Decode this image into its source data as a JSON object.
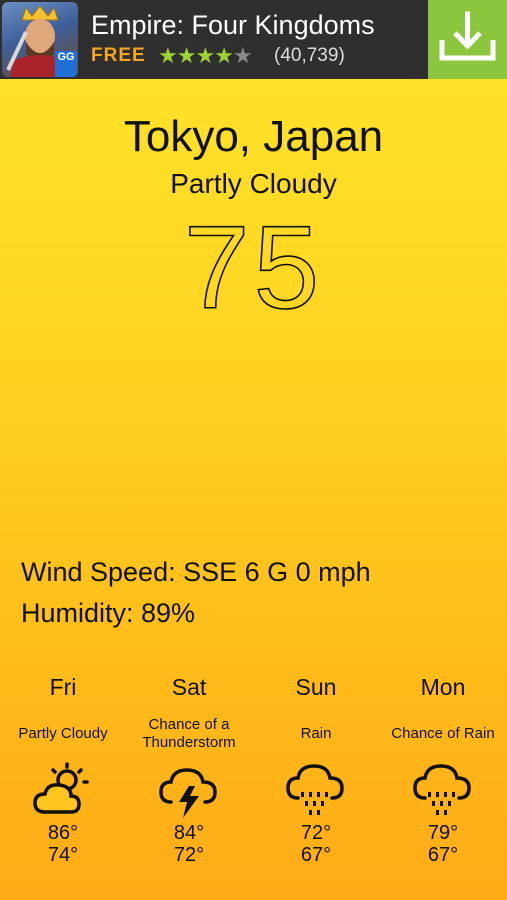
{
  "ad": {
    "title": "Empire: Four Kingdoms",
    "price": "FREE",
    "rating_stars": 4,
    "rating_count": "(40,739)",
    "icon_badge": "GG",
    "download_icon": "download-icon",
    "download_color": "#8cc63f"
  },
  "weather": {
    "city": "Tokyo, Japan",
    "condition": "Partly Cloudy",
    "temperature": "75",
    "wind": "Wind Speed: SSE 6 G 0 mph",
    "humidity": "Humidity: 89%"
  },
  "forecast": [
    {
      "day": "Fri",
      "condition": "Partly Cloudy",
      "icon": "partly-cloudy-icon",
      "high": "86°",
      "low": "74°"
    },
    {
      "day": "Sat",
      "condition": "Chance of a Thunderstorm",
      "icon": "thunderstorm-icon",
      "high": "84°",
      "low": "72°"
    },
    {
      "day": "Sun",
      "condition": "Rain",
      "icon": "rain-icon",
      "high": "72°",
      "low": "67°"
    },
    {
      "day": "Mon",
      "condition": "Chance of Rain",
      "icon": "rain-icon",
      "high": "79°",
      "low": "67°"
    }
  ]
}
